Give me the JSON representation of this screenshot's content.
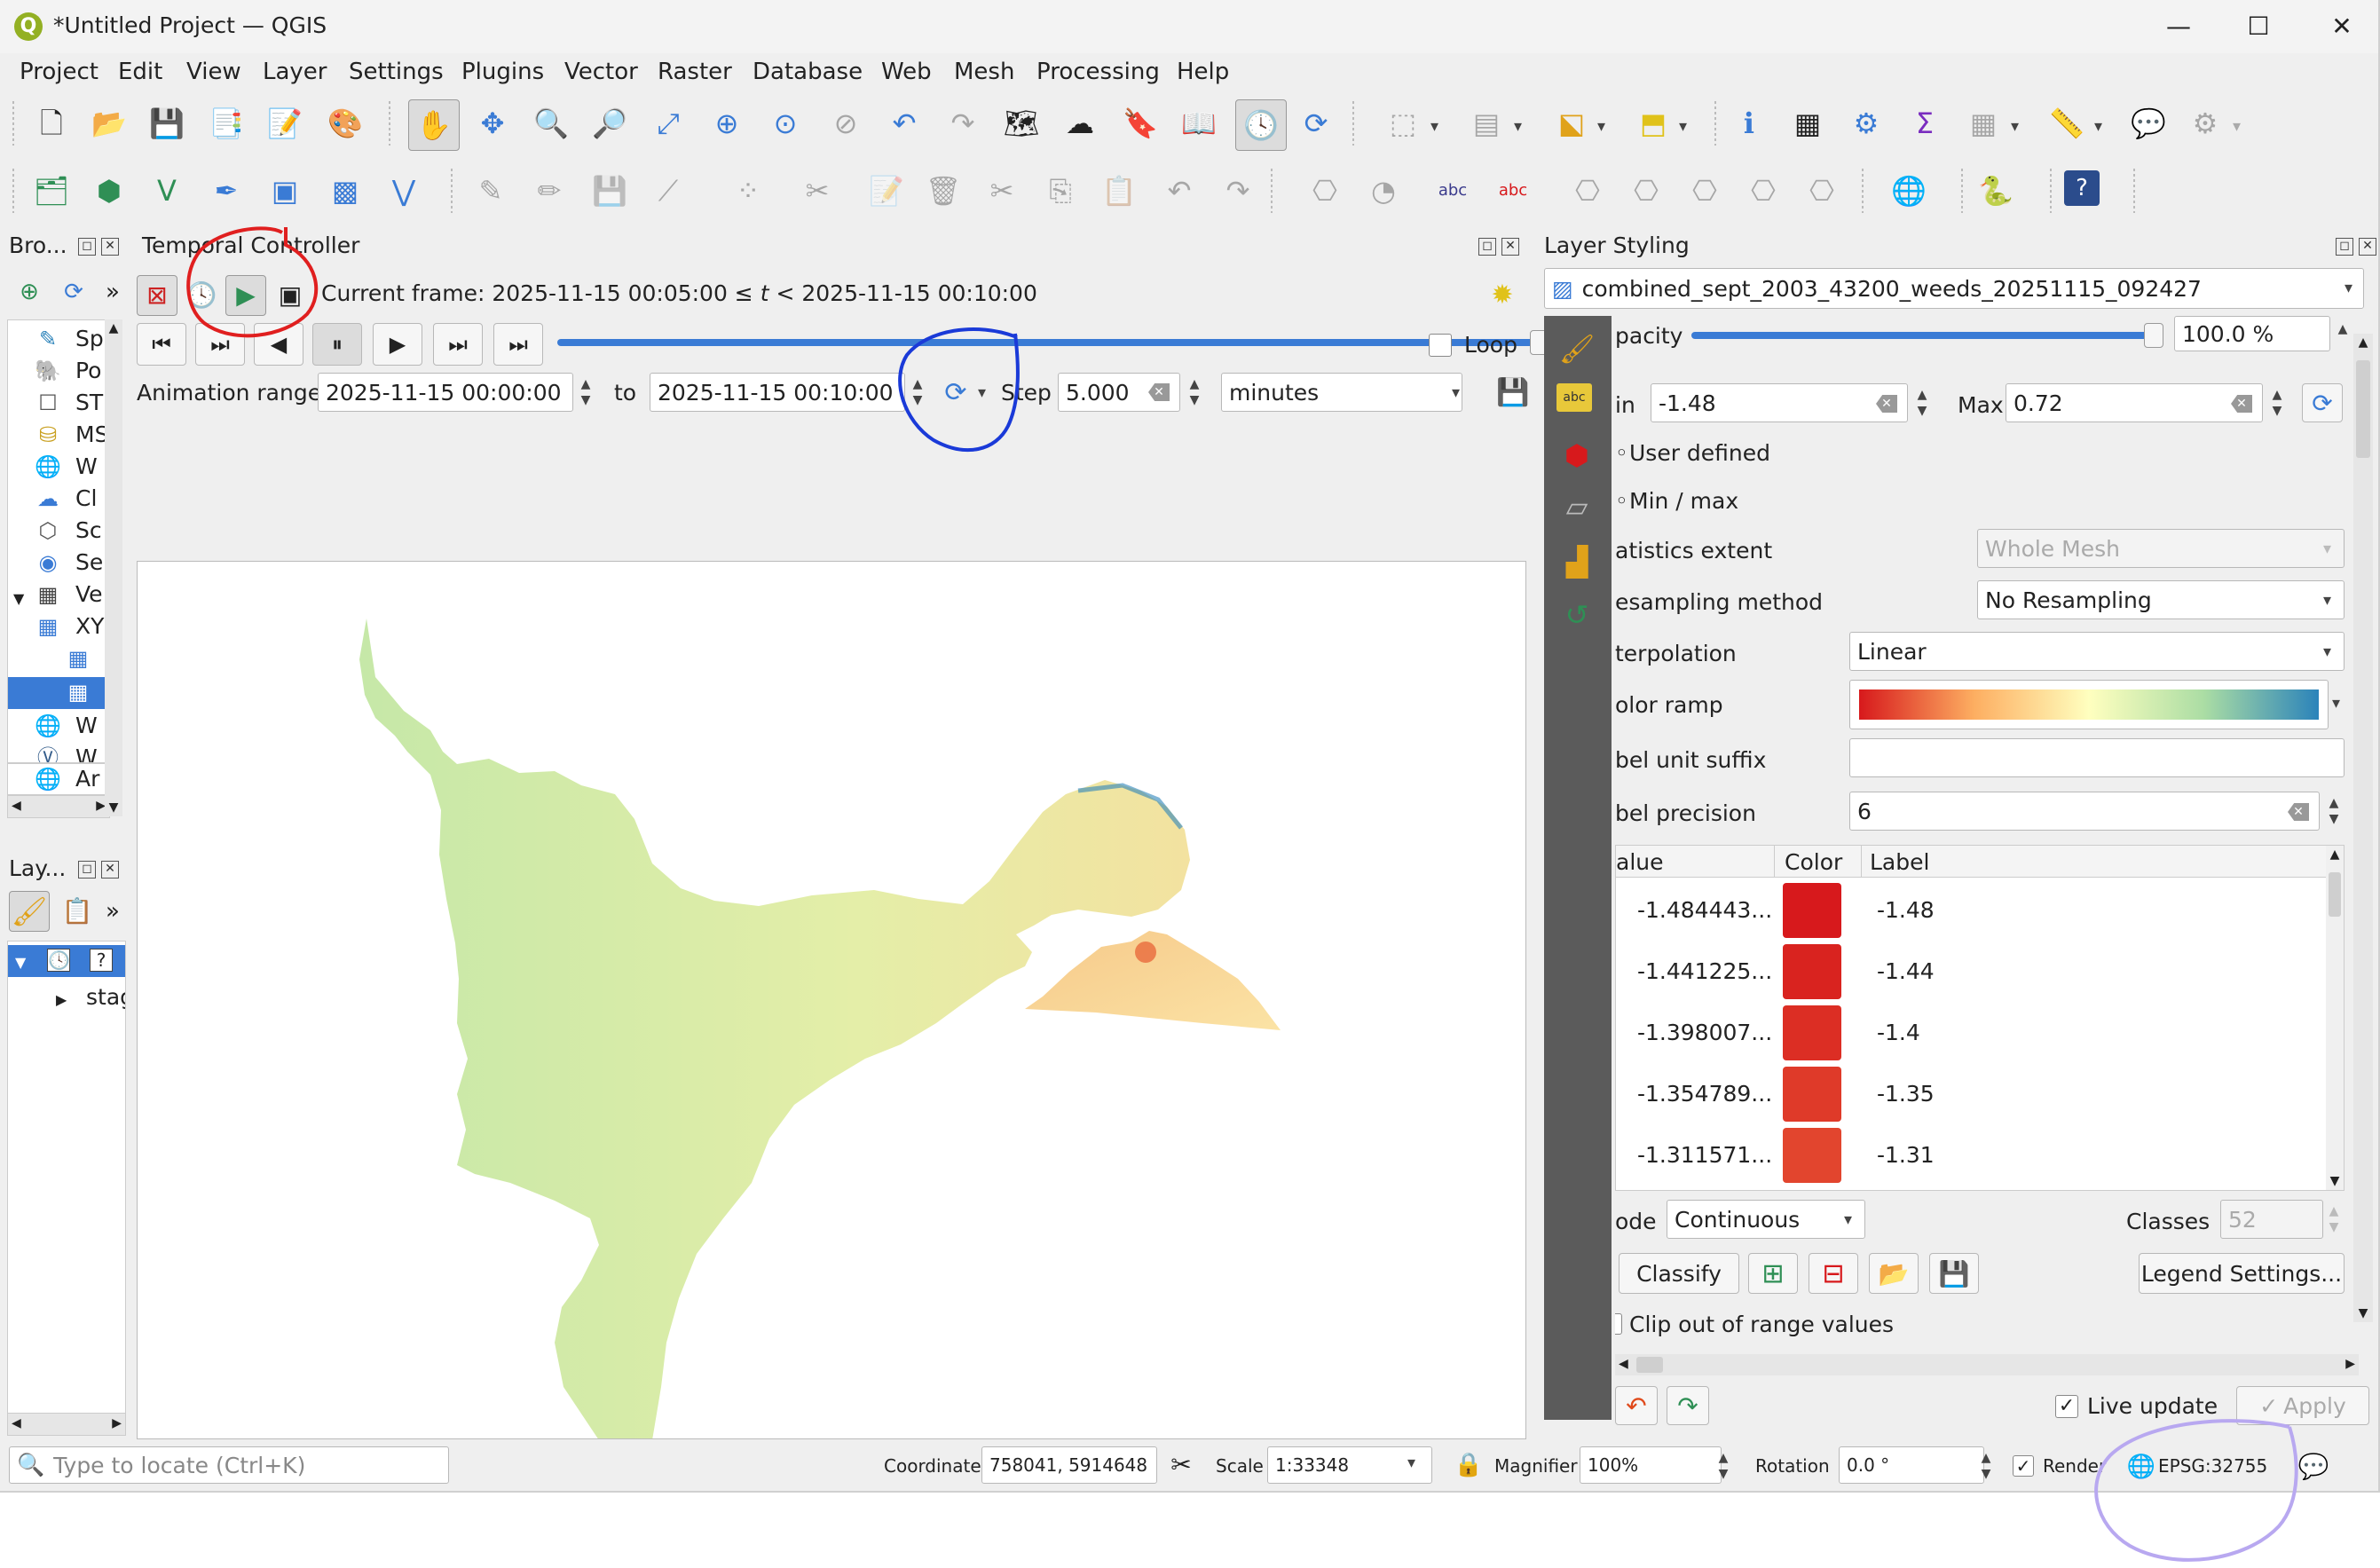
{
  "window": {
    "title": "*Untitled Project — QGIS",
    "minimize": "—",
    "maximize": "☐",
    "close": "✕"
  },
  "menus": [
    "Project",
    "Edit",
    "View",
    "Layer",
    "Settings",
    "Plugins",
    "Vector",
    "Raster",
    "Database",
    "Web",
    "Mesh",
    "Processing",
    "Help"
  ],
  "browser": {
    "title": "Bro...",
    "items": [
      {
        "label": "Sp",
        "icon": "spatialite-icon"
      },
      {
        "label": "Po",
        "icon": "postgis-icon"
      },
      {
        "label": "ST",
        "icon": "sensorthings-icon"
      },
      {
        "label": "MS",
        "icon": "mssql-icon"
      },
      {
        "label": "W",
        "icon": "wms-icon"
      },
      {
        "label": "Cl",
        "icon": "cloud-icon"
      },
      {
        "label": "Sc",
        "icon": "scenes-icon"
      },
      {
        "label": "Se",
        "icon": "sensor-icon"
      },
      {
        "label": "Ve",
        "icon": "vector-tiles-icon"
      },
      {
        "label": "XY",
        "icon": "xyz-tiles-icon"
      },
      {
        "label": "",
        "icon": "tile-icon"
      },
      {
        "label": "",
        "icon": "tile-icon"
      },
      {
        "label": "W",
        "icon": "wcs-icon"
      },
      {
        "label": "W",
        "icon": "wfs-icon"
      },
      {
        "label": "Ar",
        "icon": "arcgis-icon"
      }
    ]
  },
  "layers": {
    "title": "Lay...",
    "layer_label": "stag"
  },
  "temporal": {
    "title": "Temporal Controller",
    "current_frame": "Current frame: 2025-11-15 00:05:00 ≤ ",
    "current_frame_t": "t",
    "current_frame_end": " < 2025-11-15 00:10:00",
    "loop_label": "Loop",
    "animation_range_label": "Animation range",
    "range_start": "2025-11-15 00:00:00",
    "to_label": "to",
    "range_end": "2025-11-15 00:10:00",
    "step_label": "Step",
    "step_value": "5.000",
    "step_unit": "minutes",
    "slider_fraction": 1.0
  },
  "styling": {
    "title": "Layer Styling",
    "layer_name": "combined_sept_2003_43200_weeds_20251115_092427",
    "opacity_label": "pacity",
    "opacity_value": "100.0 %",
    "min_label": "in",
    "min_value": "-1.48",
    "max_label": "Max",
    "max_value": "0.72",
    "user_defined": "User defined",
    "min_max": "Min / max",
    "stats_extent_label": "atistics extent",
    "stats_extent_value": "Whole Mesh",
    "resampling_label": "esampling method",
    "resampling_value": "No Resampling",
    "interpolation_label": "terpolation",
    "interpolation_value": "Linear",
    "color_ramp_label": "olor ramp",
    "unit_suffix_label": "bel unit suffix",
    "unit_suffix_value": "",
    "precision_label": "bel precision",
    "precision_value": "6",
    "col_value": "alue",
    "col_color": "Color",
    "col_label": "Label",
    "rows": [
      {
        "value": "-1.484443...",
        "color": "#d7191c",
        "label": "-1.48"
      },
      {
        "value": "-1.441225...",
        "color": "#d9231f",
        "label": "-1.44"
      },
      {
        "value": "-1.398007...",
        "color": "#dc2e24",
        "label": "-1.4"
      },
      {
        "value": "-1.354789...",
        "color": "#df3a29",
        "label": "-1.35"
      },
      {
        "value": "-1.311571...",
        "color": "#e2452e",
        "label": "-1.31"
      }
    ],
    "mode_label": "ode",
    "mode_value": "Continuous",
    "classes_label": "Classes",
    "classes_value": "52",
    "classify_button": "Classify",
    "legend_settings_button": "Legend Settings...",
    "clip_label": "Clip out of range values",
    "live_update_label": "Live update",
    "apply_button": "Apply"
  },
  "statusbar": {
    "locator_placeholder": "Type to locate (Ctrl+K)",
    "coordinate_label": "Coordinate",
    "coordinate_value": "758041, 5914648",
    "scale_label": "Scale",
    "scale_value": "1:33348",
    "magnifier_label": "Magnifier",
    "magnifier_value": "100%",
    "rotation_label": "Rotation",
    "rotation_value": "0.0 °",
    "render_label": "Render",
    "crs_value": "EPSG:32755"
  },
  "colors": {
    "accent": "#3a7bd5",
    "mesh_green": "#c6e8a8",
    "ramp_start": "#d7191c",
    "ramp_end": "#2b83ba"
  }
}
